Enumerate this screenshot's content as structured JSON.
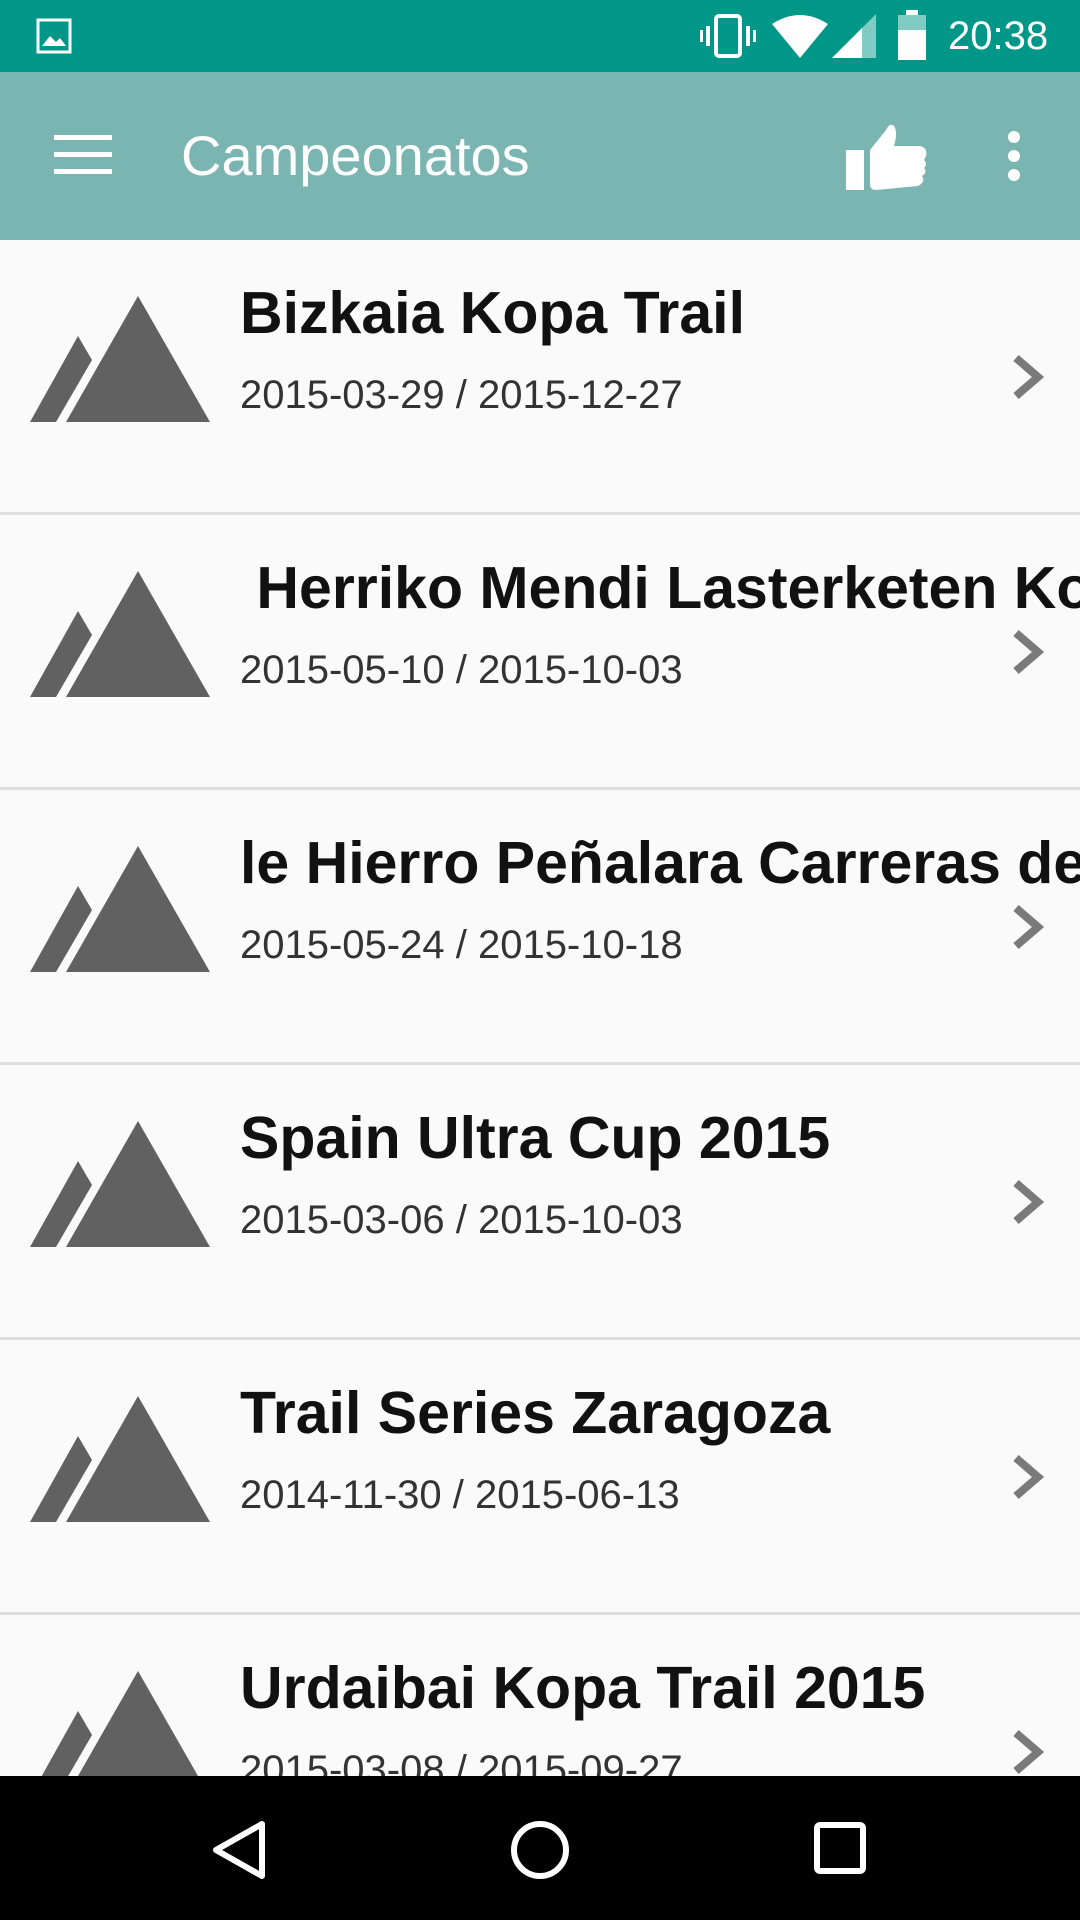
{
  "status_bar": {
    "time": "20:38",
    "icons": [
      "gallery-icon",
      "vibrate-icon",
      "wifi-icon",
      "signal-icon",
      "battery-icon"
    ]
  },
  "app_bar": {
    "title": "Campeonatos",
    "icons": [
      "menu-icon",
      "like-icon",
      "more-vert-icon"
    ]
  },
  "championships": [
    {
      "name": "Bizkaia Kopa Trail",
      "dates": "2015-03-29 / 2015-12-27"
    },
    {
      "name": " Herriko Mendi Lasterketen Kop",
      "dates": "2015-05-10 / 2015-10-03"
    },
    {
      "name": "le Hierro Peñalara Carreras de M",
      "dates": "2015-05-24 / 2015-10-18"
    },
    {
      "name": "Spain Ultra Cup 2015",
      "dates": "2015-03-06 / 2015-10-03"
    },
    {
      "name": "Trail Series Zaragoza",
      "dates": "2014-11-30 / 2015-06-13"
    },
    {
      "name": "Urdaibai Kopa Trail 2015",
      "dates": "2015-03-08 / 2015-09-27"
    }
  ],
  "nav_bar": {
    "icons": [
      "back-icon",
      "home-icon",
      "recents-icon"
    ]
  },
  "colors": {
    "status_bar": "#009688",
    "app_bar": "#7bb5b2",
    "mountain_icon": "#616161"
  }
}
